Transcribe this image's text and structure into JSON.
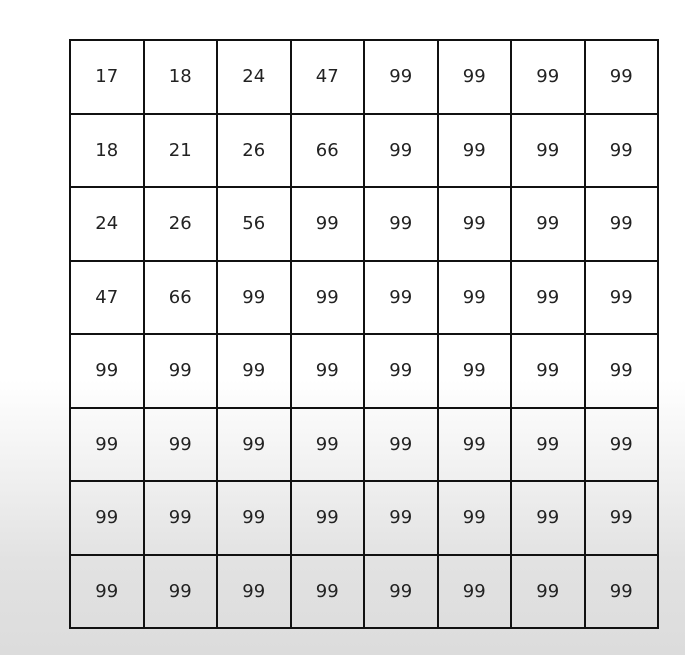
{
  "matrix": {
    "rows": [
      [
        "17",
        "18",
        "24",
        "47",
        "99",
        "99",
        "99",
        "99"
      ],
      [
        "18",
        "21",
        "26",
        "66",
        "99",
        "99",
        "99",
        "99"
      ],
      [
        "24",
        "26",
        "56",
        "99",
        "99",
        "99",
        "99",
        "99"
      ],
      [
        "47",
        "66",
        "99",
        "99",
        "99",
        "99",
        "99",
        "99"
      ],
      [
        "99",
        "99",
        "99",
        "99",
        "99",
        "99",
        "99",
        "99"
      ],
      [
        "99",
        "99",
        "99",
        "99",
        "99",
        "99",
        "99",
        "99"
      ],
      [
        "99",
        "99",
        "99",
        "99",
        "99",
        "99",
        "99",
        "99"
      ],
      [
        "99",
        "99",
        "99",
        "99",
        "99",
        "99",
        "99",
        "99"
      ]
    ]
  }
}
